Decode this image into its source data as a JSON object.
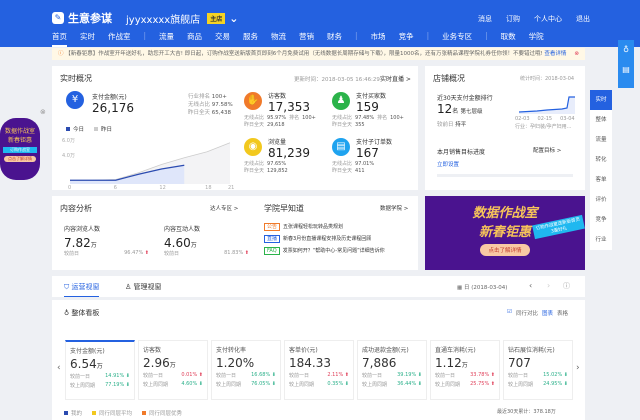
{
  "header": {
    "brand": "生意参谋",
    "shop": "jyyxxxxx旗舰店",
    "badge": "主店",
    "links": [
      "消息",
      "订购",
      "个人中心",
      "退出"
    ]
  },
  "nav": [
    "首页",
    "实时",
    "作战室",
    "|",
    "流量",
    "商品",
    "交易",
    "服务",
    "物流",
    "营销",
    "财务",
    "|",
    "市场",
    "竞争",
    "|",
    "业务专区",
    "|",
    "取数",
    "学院"
  ],
  "notice": {
    "text": "【新春钜惠】作战室开年送好礼，助您开工大吉! 即日起，订购作战室送新版首页即刻6个月免费试用（无线数据长周期存储与下载），限量1000名，还有万张精品课程学院礼券任你领！不要错过哦!",
    "link": "查看详情"
  },
  "realtime": {
    "title": "实时概况",
    "updated": "更新时间：2018-03-05 16:46:29",
    "live": "实时直播 >",
    "pay": {
      "label": "支付金额(元)",
      "value": "26,176",
      "rows": [
        [
          "行业排名",
          "100+"
        ],
        [
          "无线占比",
          "97.58%"
        ],
        [
          "昨日全天",
          "65,438"
        ]
      ]
    },
    "legend": [
      "今日",
      "昨日"
    ],
    "y_ticks": [
      "6.0万",
      "4.0万"
    ],
    "x_ticks": [
      "0",
      "6",
      "12",
      "18",
      "21"
    ],
    "stats": [
      {
        "label": "访客数",
        "value": "17,353",
        "rows": [
          [
            "无线占比",
            "95.97%",
            "排名",
            "100+"
          ],
          [
            "昨日全天",
            "29,618"
          ]
        ]
      },
      {
        "label": "支付买家数",
        "value": "159",
        "rows": [
          [
            "无线占比",
            "97.48%",
            "排名",
            "100+"
          ],
          [
            "昨日全天",
            "355"
          ]
        ]
      },
      {
        "label": "浏览量",
        "value": "81,239",
        "rows": [
          [
            "无线占比",
            "97.65%"
          ],
          [
            "昨日全天",
            "129,852"
          ]
        ]
      },
      {
        "label": "支付子订单数",
        "value": "167",
        "rows": [
          [
            "无线占比",
            "97.01%"
          ],
          [
            "昨日全天",
            "411"
          ]
        ]
      }
    ],
    "colors": {
      "pay": "#2461e0",
      "visitors": "#f07a2a",
      "buyers": "#2bb34a",
      "pv": "#f2c81e",
      "orders": "#1fa3ef"
    }
  },
  "chart_data": {
    "type": "line",
    "x": [
      0,
      3,
      6,
      9,
      12,
      15,
      18,
      21
    ],
    "series": [
      {
        "name": "今日",
        "values": [
          0.5,
          0.5,
          0.5,
          1.3,
          2.0,
          2.5
        ]
      },
      {
        "name": "昨日",
        "values": [
          0.5,
          0.5,
          0.6,
          1.5,
          2.6,
          3.5,
          4.3,
          5.5
        ]
      }
    ],
    "ylim": [
      0,
      6
    ],
    "yunit": "万元"
  },
  "store": {
    "title": "店铺概况",
    "date": "统计时间：2018-03-04",
    "rank_label": "近30天支付金额排行",
    "rank": "12",
    "rank_unit": "名",
    "level": "第七层级",
    "prev": "较前日",
    "prev_val": "持平",
    "x_ticks": [
      "02-03",
      "02-15",
      "03-04"
    ],
    "industry": "行业：孕妇装/孕产妇用...",
    "goal": "本月销售目标进度",
    "goal_link": "配置目标 >",
    "set": "立即设置"
  },
  "content": {
    "title": "内容分析",
    "link": "达人专区 >",
    "m": [
      {
        "label": "内容浏览人数",
        "value": "7.82",
        "unit": "万",
        "cmp": "较前日",
        "pct": "96.47%"
      },
      {
        "label": "内容互动人数",
        "value": "4.60",
        "unit": "万",
        "cmp": "较前日",
        "pct": "81.83%"
      }
    ]
  },
  "academy": {
    "title": "学院早知道",
    "link": "数据学院 >",
    "items": [
      {
        "tag": "公告",
        "text": "五张课程轻松玩转品类规划"
      },
      {
        "tag": "直播",
        "text": "新春3月份直播课程安排及历史课程回顾"
      },
      {
        "tag": "FAQ",
        "text": "发票如何开？“帮助中心-常见问题”详细告诉你"
      }
    ]
  },
  "banner": {
    "l1": "数据作战室",
    "l2": "新春钜惠",
    "tag": "订购作战室送新版首页",
    "tag2": "3重好礼",
    "btn": "点击了解详情"
  },
  "leftad": {
    "l1": "数据作战室",
    "l2": "新春钜惠",
    "tag": "订购作战室",
    "btn": "点击了解详情"
  },
  "tabs": {
    "items": [
      "运营视窗",
      "管理视窗"
    ],
    "date": "日 (2018-03-04)"
  },
  "board": {
    "title": "整体看板",
    "compare": "同行对比",
    "chart": "图表",
    "table": "表格",
    "cards": [
      {
        "t": "支付金额(元)",
        "v": "6.54",
        "u": "万",
        "a": [
          "较前一日",
          "14.91%",
          "dn"
        ],
        "b": [
          "较上周同期",
          "77.19%",
          "dn"
        ]
      },
      {
        "t": "访客数",
        "v": "2.96",
        "u": "万",
        "a": [
          "较前一日",
          "0.01%",
          "up"
        ],
        "b": [
          "较上周同期",
          "4.60%",
          "dn"
        ]
      },
      {
        "t": "支付转化率",
        "v": "1.20%",
        "u": "",
        "a": [
          "较前一日",
          "16.68%",
          "dn"
        ],
        "b": [
          "较上周同期",
          "76.05%",
          "dn"
        ]
      },
      {
        "t": "客单价(元)",
        "v": "184.33",
        "u": "",
        "a": [
          "较前一日",
          "2.11%",
          "up"
        ],
        "b": [
          "较上周同期",
          "0.35%",
          "dn"
        ]
      },
      {
        "t": "成功退款金额(元)",
        "v": "7,886",
        "u": "",
        "a": [
          "较前一日",
          "39.19%",
          "dn"
        ],
        "b": [
          "较上周同期",
          "36.44%",
          "dn"
        ]
      },
      {
        "t": "直通车消耗(元)",
        "v": "1.12",
        "u": "万",
        "a": [
          "较前一日",
          "33.78%",
          "up"
        ],
        "b": [
          "较上周同期",
          "25.75%",
          "up"
        ]
      },
      {
        "t": "钻石展位消耗(元)",
        "v": "707",
        "u": "",
        "a": [
          "较前一日",
          "15.02%",
          "dn"
        ],
        "b": [
          "较上周同期",
          "24.95%",
          "dn"
        ]
      }
    ],
    "legend": [
      "我的",
      "同行同层平均",
      "同行同层优秀"
    ],
    "total": "最近30天累计：378.18万"
  },
  "vtabs": [
    "实时",
    "整体",
    "流量",
    "转化",
    "客单",
    "评价",
    "竞争",
    "行业"
  ]
}
